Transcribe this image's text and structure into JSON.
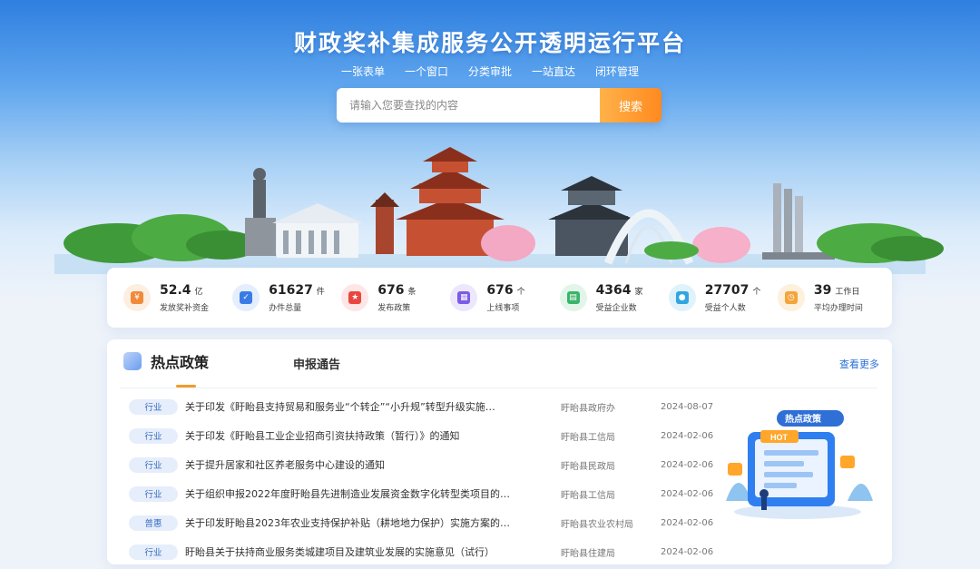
{
  "hero": {
    "title": "财政奖补集成服务公开透明运行平台",
    "tags": [
      "一张表单",
      "一个窗口",
      "分类审批",
      "一站直达",
      "闭环管理"
    ]
  },
  "search": {
    "placeholder": "请输入您要查找的内容",
    "button": "搜索"
  },
  "stats": [
    {
      "value": "52.4",
      "unit": "亿",
      "label": "发放奖补资金",
      "icon": "money-bag-icon",
      "color": "#f08a3b"
    },
    {
      "value": "61627",
      "unit": "件",
      "label": "办件总量",
      "icon": "clipboard-check-icon",
      "color": "#3a7ce6"
    },
    {
      "value": "676",
      "unit": "条",
      "label": "发布政策",
      "icon": "policy-document-icon",
      "color": "#e8473f"
    },
    {
      "value": "676",
      "unit": "个",
      "label": "上线事项",
      "icon": "building-icon",
      "color": "#7b5ce6"
    },
    {
      "value": "4364",
      "unit": "家",
      "label": "受益企业数",
      "icon": "enterprise-icon",
      "color": "#3bb46b"
    },
    {
      "value": "27707",
      "unit": "个",
      "label": "受益个人数",
      "icon": "person-icon",
      "color": "#2fa6e0"
    },
    {
      "value": "39",
      "unit": "工作日",
      "label": "平均办理时间",
      "icon": "clock-icon",
      "color": "#f3a53a"
    }
  ],
  "policy": {
    "tab_hot": "热点政策",
    "tab_notice": "申报通告",
    "view_more": "查看更多",
    "illustration_badge": "热点政策",
    "illustration_hot": "HOT",
    "rows": [
      {
        "tag": "行业",
        "title": "关于印发《盱眙县支持贸易和服务业“个转企”“小升规”转型升级实施…",
        "dept": "盱眙县政府办",
        "date": "2024-08-07"
      },
      {
        "tag": "行业",
        "title": "关于印发《盱眙县工业企业招商引资扶持政策（暂行）》的通知",
        "dept": "盱眙县工信局",
        "date": "2024-02-06"
      },
      {
        "tag": "行业",
        "title": "关于提升居家和社区养老服务中心建设的通知",
        "dept": "盱眙县民政局",
        "date": "2024-02-06"
      },
      {
        "tag": "行业",
        "title": "关于组织申报2022年度盱眙县先进制造业发展资金数字化转型类项目的…",
        "dept": "盱眙县工信局",
        "date": "2024-02-06"
      },
      {
        "tag": "普惠",
        "title": "关于印发盱眙县2023年农业支持保护补贴（耕地地力保护）实施方案的…",
        "dept": "盱眙县农业农村局",
        "date": "2024-02-06"
      },
      {
        "tag": "行业",
        "title": "盱眙县关于扶持商业服务类城建项目及建筑业发展的实施意见（试行）",
        "dept": "盱眙县住建局",
        "date": "2024-02-06"
      }
    ]
  }
}
